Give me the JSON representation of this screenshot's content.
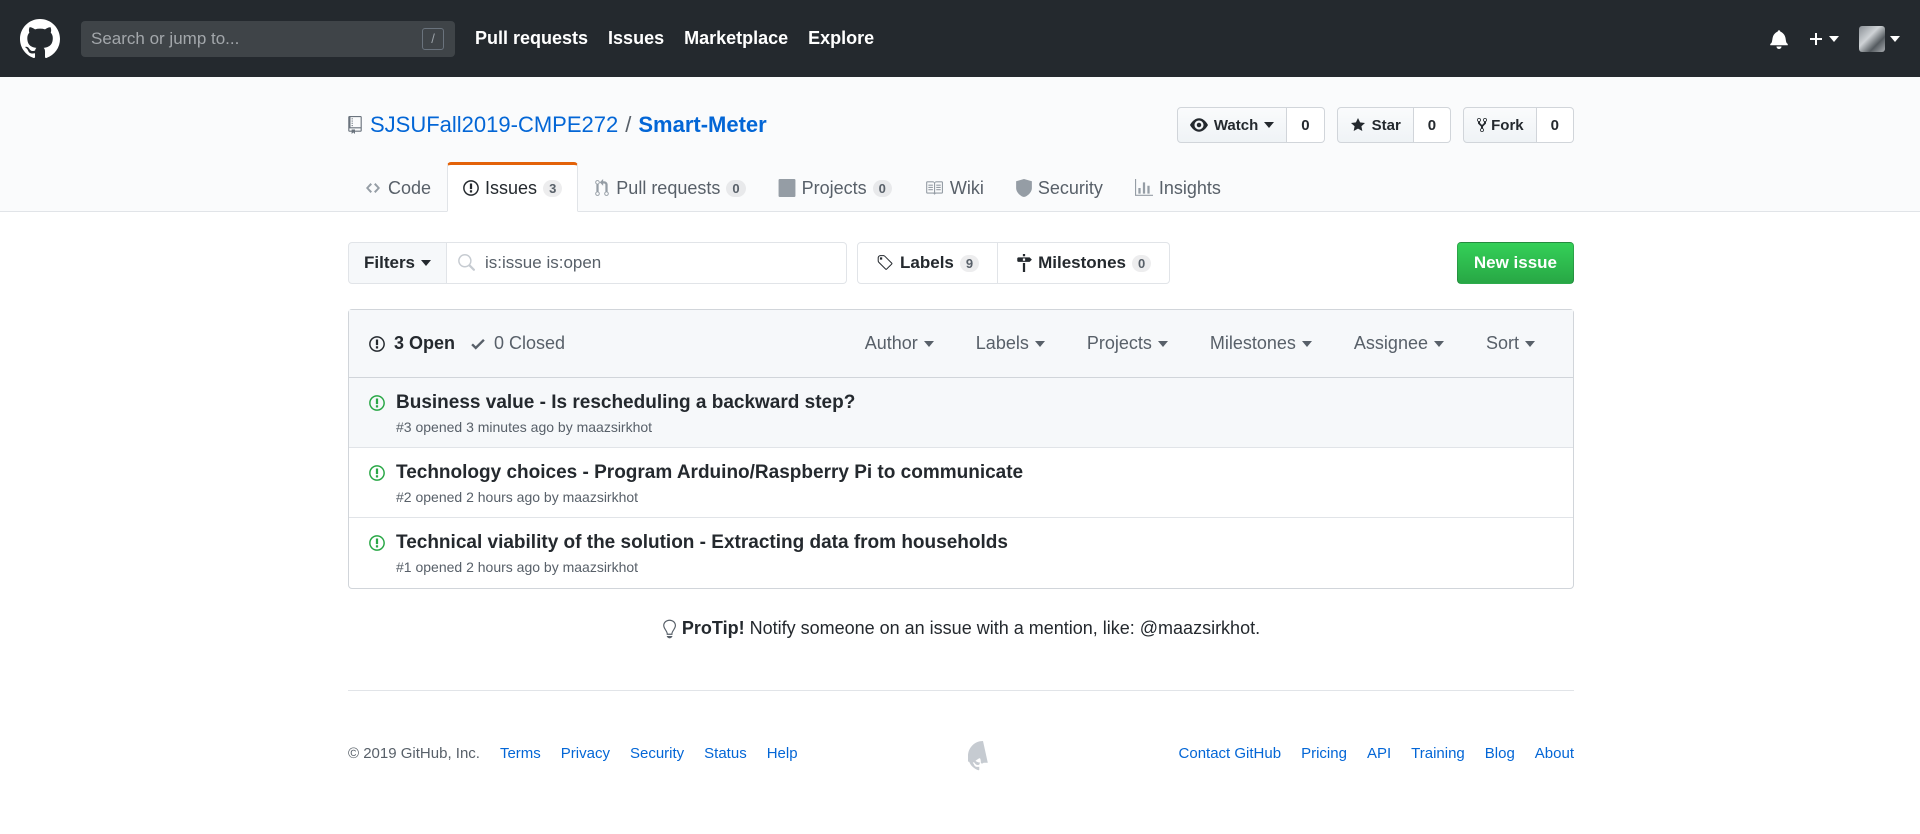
{
  "header": {
    "search_placeholder": "Search or jump to...",
    "slash_hint": "/",
    "nav": [
      "Pull requests",
      "Issues",
      "Marketplace",
      "Explore"
    ]
  },
  "repo": {
    "owner": "SJSUFall2019-CMPE272",
    "separator": "/",
    "name": "Smart-Meter",
    "watch_label": "Watch",
    "watch_count": "0",
    "star_label": "Star",
    "star_count": "0",
    "fork_label": "Fork",
    "fork_count": "0"
  },
  "tabs": [
    {
      "label": "Code"
    },
    {
      "label": "Issues",
      "count": "3"
    },
    {
      "label": "Pull requests",
      "count": "0"
    },
    {
      "label": "Projects",
      "count": "0"
    },
    {
      "label": "Wiki"
    },
    {
      "label": "Security"
    },
    {
      "label": "Insights"
    }
  ],
  "subnav": {
    "filters_label": "Filters",
    "search_value": "is:issue is:open",
    "labels_label": "Labels",
    "labels_count": "9",
    "milestones_label": "Milestones",
    "milestones_count": "0",
    "new_issue_label": "New issue"
  },
  "issues_header": {
    "open_label": "3 Open",
    "closed_label": "0 Closed",
    "sorts": [
      "Author",
      "Labels",
      "Projects",
      "Milestones",
      "Assignee",
      "Sort"
    ]
  },
  "issues": [
    {
      "title": "Business value - Is rescheduling a backward step?",
      "meta": "#3 opened 3 minutes ago by maazsirkhot"
    },
    {
      "title": "Technology choices - Program Arduino/Raspberry Pi to communicate",
      "meta": "#2 opened 2 hours ago by maazsirkhot"
    },
    {
      "title": "Technical viability of the solution - Extracting data from households",
      "meta": "#1 opened 2 hours ago by maazsirkhot"
    }
  ],
  "protip": {
    "label": "ProTip!",
    "text": "Notify someone on an issue with a mention, like: @maazsirkhot."
  },
  "footer": {
    "copyright": "© 2019 GitHub, Inc.",
    "left_links": [
      "Terms",
      "Privacy",
      "Security",
      "Status",
      "Help"
    ],
    "right_links": [
      "Contact GitHub",
      "Pricing",
      "API",
      "Training",
      "Blog",
      "About"
    ]
  },
  "colors": {
    "header_bg": "#24292e",
    "link": "#0366d6",
    "issue_open": "#28a745",
    "active_tab": "#e36209",
    "new_issue_button": "#2ea44f"
  }
}
